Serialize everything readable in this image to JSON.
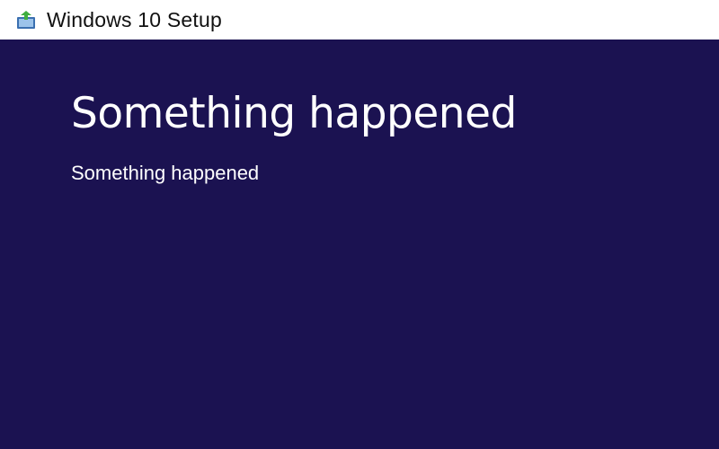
{
  "window": {
    "title": "Windows 10 Setup",
    "icon": "setup-disc-icon"
  },
  "main": {
    "heading": "Something happened",
    "message": "Something happened"
  },
  "colors": {
    "background": "#1b1251",
    "titlebar": "#ffffff",
    "text": "#ffffff"
  }
}
